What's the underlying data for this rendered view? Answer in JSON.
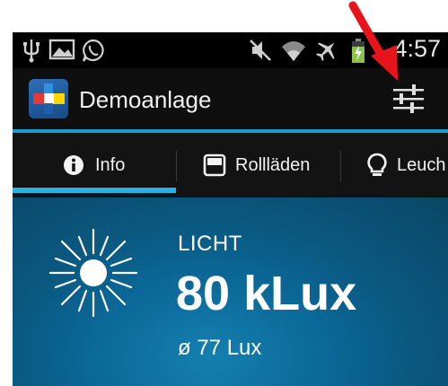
{
  "statusbar": {
    "time": "4:57"
  },
  "actionbar": {
    "title": "Demoanlage"
  },
  "tabs": [
    {
      "label": "Info",
      "icon": "info-icon",
      "selected": true
    },
    {
      "label": "Rollläden",
      "icon": "shutter-icon",
      "selected": false
    },
    {
      "label": "Leuch",
      "icon": "lightbulb-icon",
      "selected": false
    }
  ],
  "content": {
    "label": "LICHT",
    "value": "80 kLux",
    "average": "ø 77 Lux"
  },
  "colors": {
    "accent": "#2bb0e4",
    "content_bg": "#0b6898",
    "annotation_arrow": "#e8141b"
  }
}
